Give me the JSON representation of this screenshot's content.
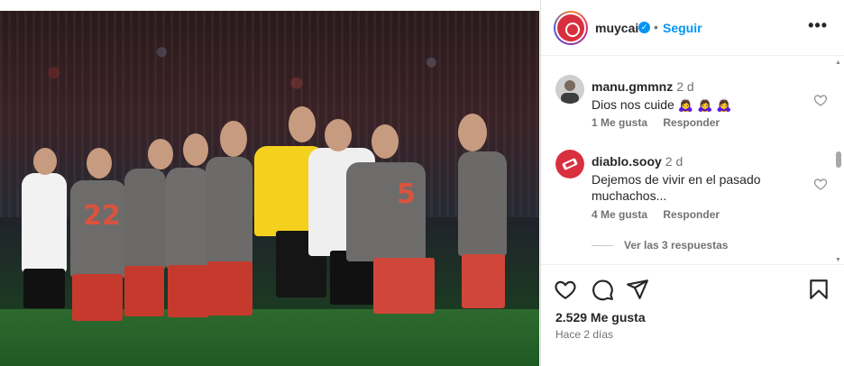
{
  "post": {
    "username": "muycai",
    "follow_label": "Seguir",
    "separator": "•",
    "more_label": "•••"
  },
  "comments": [
    {
      "username": "manu.gmmnz",
      "time": "2 d",
      "text": "Dios nos cuide 🙇‍♀️ 🙇‍♀️ 🙇‍♀️",
      "likes": "1 Me gusta",
      "reply": "Responder"
    },
    {
      "username": "diablo.sooy",
      "time": "2 d",
      "text": "Dejemos de vivir en el pasado muchachos...",
      "likes": "4 Me gusta",
      "reply": "Responder",
      "view_replies": "Ver las 3 respuestas"
    }
  ],
  "footer": {
    "likes": "2.529 Me gusta",
    "time_ago": "Hace 2 días"
  },
  "icons": {
    "heart": "heart-icon",
    "comment": "comment-icon",
    "share": "share-icon",
    "save": "bookmark-icon",
    "verified": "verified-badge-icon"
  },
  "colors": {
    "link_blue": "#0095f6",
    "text": "#262626",
    "secondary": "#737373"
  }
}
